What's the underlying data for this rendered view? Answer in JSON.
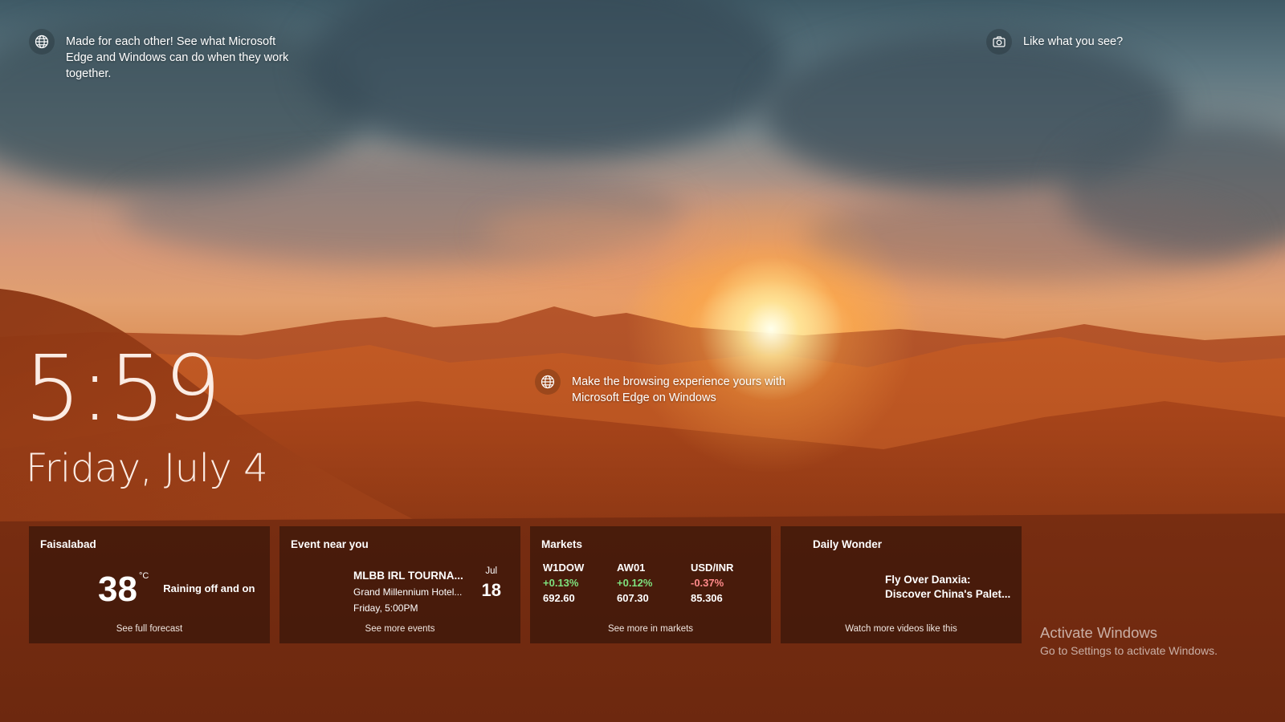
{
  "tips": {
    "top_left": "Made for each other! See what Microsoft Edge and Windows can do when they work together.",
    "top_right": "Like what you see?",
    "center": "Make the browsing experience yours with Microsoft Edge on Windows"
  },
  "clock": {
    "time": "5:59",
    "date": "Friday, July 4"
  },
  "cards": {
    "weather": {
      "title": "Faisalabad",
      "temperature": "38",
      "unit": "°C",
      "condition": "Raining off and on",
      "link": "See full forecast"
    },
    "event": {
      "title": "Event near you",
      "name": "MLBB IRL TOURNA...",
      "venue": "Grand Millennium Hotel...",
      "when": "Friday, 5:00PM",
      "month": "Jul",
      "day": "18",
      "link": "See more events"
    },
    "markets": {
      "title": "Markets",
      "items": [
        {
          "symbol": "W1DOW",
          "change": "+0.13%",
          "value": "692.60"
        },
        {
          "symbol": "AW01",
          "change": "+0.12%",
          "value": "607.30"
        },
        {
          "symbol": "USD/INR",
          "change": "-0.37%",
          "value": "85.306"
        }
      ],
      "link": "See more in markets"
    },
    "wonder": {
      "title": "Daily Wonder",
      "video_title": "Fly Over Danxia: Discover China's Palet...",
      "link": "Watch more videos like this"
    }
  },
  "watermark": {
    "line1": "Activate Windows",
    "line2": "Go to Settings to activate Windows."
  },
  "colors": {
    "positive": "#7ee27e",
    "negative": "#ff8a8a"
  },
  "icons": {
    "tip": "globe-icon",
    "camera": "camera-icon"
  }
}
